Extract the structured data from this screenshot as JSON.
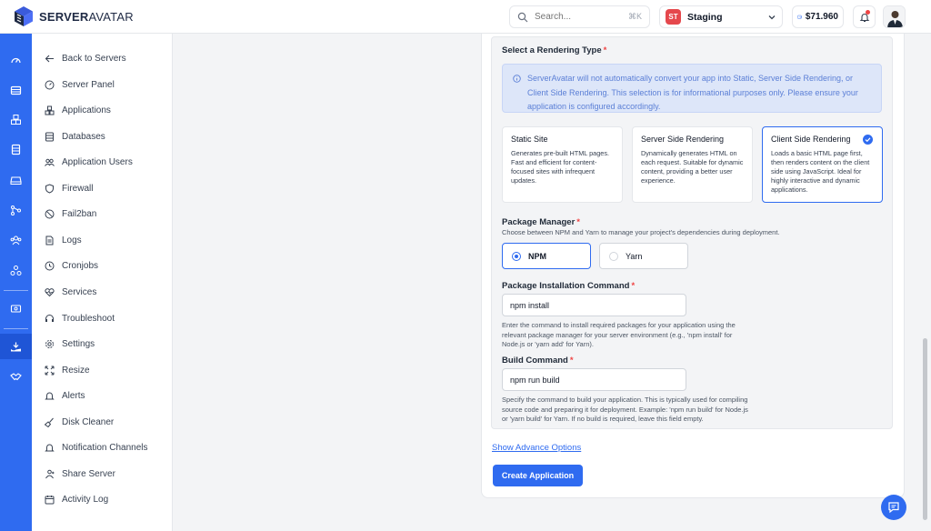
{
  "brand": {
    "bold": "SERVER",
    "light": "AVATAR"
  },
  "search": {
    "placeholder": "Search...",
    "shortcut": "⌘K"
  },
  "server": {
    "badge": "ST",
    "name": "Staging"
  },
  "balance": {
    "amount": "$71.960"
  },
  "colors": {
    "primary": "#2f6bf0",
    "danger": "#ef4444"
  },
  "sidebar": {
    "items": [
      {
        "label": "Back to Servers",
        "icon": "arrow-left-icon"
      },
      {
        "label": "Server Panel",
        "icon": "gauge-icon"
      },
      {
        "label": "Applications",
        "icon": "cubes-icon"
      },
      {
        "label": "Databases",
        "icon": "database-icon"
      },
      {
        "label": "Application Users",
        "icon": "users-icon"
      },
      {
        "label": "Firewall",
        "icon": "shield-icon"
      },
      {
        "label": "Fail2ban",
        "icon": "ban-icon"
      },
      {
        "label": "Logs",
        "icon": "file-icon"
      },
      {
        "label": "Cronjobs",
        "icon": "clock-icon"
      },
      {
        "label": "Services",
        "icon": "heart-pulse-icon"
      },
      {
        "label": "Troubleshoot",
        "icon": "headset-icon"
      },
      {
        "label": "Settings",
        "icon": "gear-icon"
      },
      {
        "label": "Resize",
        "icon": "resize-icon"
      },
      {
        "label": "Alerts",
        "icon": "bell-icon"
      },
      {
        "label": "Disk Cleaner",
        "icon": "broom-icon"
      },
      {
        "label": "Notification Channels",
        "icon": "bell-icon"
      },
      {
        "label": "Share Server",
        "icon": "share-icon"
      },
      {
        "label": "Activity Log",
        "icon": "calendar-icon"
      }
    ]
  },
  "rendering": {
    "label": "Select a Rendering Type",
    "info": "ServerAvatar will not automatically convert your app into Static, Server Side Rendering, or Client Side Rendering. This selection is for informational purposes only. Please ensure your application is configured accordingly.",
    "options": [
      {
        "title": "Static Site",
        "desc": "Generates pre-built HTML pages. Fast and efficient for content-focused sites with infrequent updates."
      },
      {
        "title": "Server Side Rendering",
        "desc": "Dynamically generates HTML on each request. Suitable for dynamic content, providing a better user experience."
      },
      {
        "title": "Client Side Rendering",
        "desc": "Loads a basic HTML page first, then renders content on the client side using JavaScript. Ideal for highly interactive and dynamic applications."
      }
    ],
    "selected": "Client Side Rendering"
  },
  "package_manager": {
    "label": "Package Manager",
    "help": "Choose between NPM and Yarn to manage your project's dependencies during deployment.",
    "options": [
      "NPM",
      "Yarn"
    ],
    "selected": "NPM"
  },
  "install_command": {
    "label": "Package Installation Command",
    "value": "npm install",
    "help": "Enter the command to install required packages for your application using the relevant package manager for your server environment (e.g., 'npm install' for Node.js or 'yarn add' for Yarn)."
  },
  "build_command": {
    "label": "Build Command",
    "value": "npm run build",
    "help": "Specify the command to build your application. This is typically used for compiling source code and preparing it for deployment. Example: 'npm run build' for Node.js or 'yarn build' for Yarn. If no build is required, leave this field empty."
  },
  "advanced_link": "Show Advance Options",
  "create_button": "Create Application"
}
